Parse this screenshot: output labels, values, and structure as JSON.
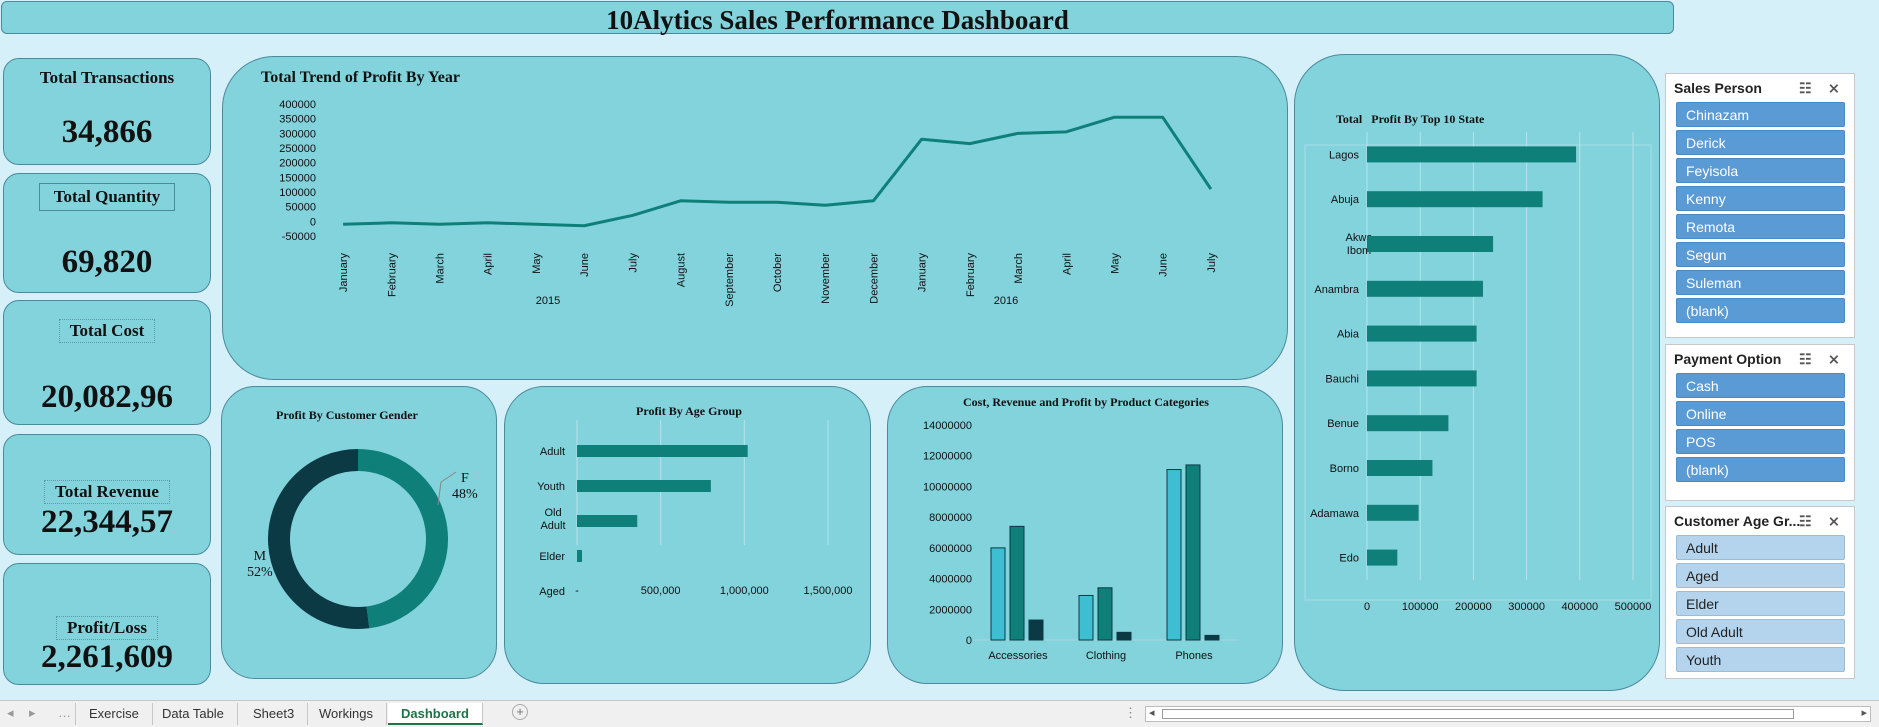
{
  "title": "10Alytics Sales Performance Dashboard",
  "kpis": [
    {
      "label": "Total Transactions",
      "value": "34,866"
    },
    {
      "label": "Total Quantity",
      "value": "69,820"
    },
    {
      "label": "Total Cost",
      "value": "20,082,96"
    },
    {
      "label": "Total Revenue",
      "value": "22,344,57"
    },
    {
      "label": "Profit/Loss",
      "value": "2,261,609"
    }
  ],
  "trend": {
    "title": "Total Trend of Profit By Year",
    "y_ticks": [
      "400000",
      "350000",
      "300000",
      "250000",
      "200000",
      "150000",
      "100000",
      "50000",
      "0",
      "-50000"
    ],
    "months": [
      "January",
      "February",
      "March",
      "April",
      "May",
      "June",
      "July",
      "August",
      "September",
      "October",
      "November",
      "December",
      "January",
      "February",
      "March",
      "April",
      "May",
      "June",
      "July"
    ],
    "years": [
      "2015",
      "2016"
    ],
    "chart_data": {
      "type": "line",
      "x": [
        "January",
        "February",
        "March",
        "April",
        "May",
        "June",
        "July",
        "August",
        "September",
        "October",
        "November",
        "December",
        "January",
        "February",
        "March",
        "April",
        "May",
        "June",
        "July"
      ],
      "values": [
        -10000,
        -5000,
        -10000,
        -5000,
        -10000,
        -15000,
        20000,
        70000,
        65000,
        65000,
        55000,
        70000,
        280000,
        265000,
        300000,
        305000,
        355000,
        355000,
        110000
      ],
      "ylim": [
        -50000,
        400000
      ],
      "color": "#0f7f7a"
    }
  },
  "states": {
    "title": "Total   Profit By Top 10 State",
    "x_ticks": [
      "0",
      "100000",
      "200000",
      "300000",
      "400000",
      "500000"
    ],
    "chart_data": {
      "type": "bar",
      "categories": [
        "Lagos",
        "Abuja",
        "Akwa Ibom",
        "Anambra",
        "Abia",
        "Bauchi",
        "Benue",
        "Borno",
        "Adamawa",
        "Edo"
      ],
      "values": [
        393000,
        330000,
        237000,
        218000,
        206000,
        206000,
        153000,
        123000,
        97000,
        57000
      ],
      "xlim": [
        0,
        500000
      ],
      "color": "#0f7f7a"
    }
  },
  "gender": {
    "title": "Profit By Customer Gender",
    "m_label": "M",
    "m_pct": "52%",
    "f_label": "F",
    "f_pct": "48%",
    "chart_data": {
      "type": "pie",
      "categories": [
        "F",
        "M"
      ],
      "values": [
        48,
        52
      ],
      "colors": [
        "#0f7f7a",
        "#0b3a45"
      ]
    }
  },
  "age": {
    "title": "Profit By Age Group",
    "x_ticks": [
      "-",
      "500,000",
      "1,000,000",
      "1,500,000"
    ],
    "chart_data": {
      "type": "bar",
      "categories": [
        "Adult",
        "Youth",
        "Old Adult",
        "Elder",
        "Aged"
      ],
      "values": [
        1020000,
        800000,
        360000,
        30000,
        0
      ],
      "xlim": [
        0,
        1500000
      ],
      "color": "#0f7f7a"
    }
  },
  "categories": {
    "title": "Cost, Revenue and Profit by Product Categories",
    "y_ticks": [
      "14000000",
      "12000000",
      "10000000",
      "8000000",
      "6000000",
      "4000000",
      "2000000",
      "0"
    ],
    "chart_data": {
      "type": "bar",
      "categories": [
        "Accessories",
        "Clothing",
        "Phones"
      ],
      "series": [
        {
          "values": [
            6000000,
            2900000,
            11100000
          ],
          "color": "#3ebed1"
        },
        {
          "values": [
            7400000,
            3400000,
            11400000
          ],
          "color": "#0f7f7a"
        },
        {
          "values": [
            1300000,
            500000,
            300000
          ],
          "color": "#0b3a45"
        }
      ],
      "ylim": [
        0,
        14000000
      ]
    }
  },
  "slicers": [
    {
      "title": "Sales Person",
      "items": [
        "Chinazam",
        "Derick",
        "Feyisola",
        "Kenny",
        "Remota",
        "Segun",
        "Suleman",
        "(blank)"
      ]
    },
    {
      "title": "Payment Option",
      "items": [
        "Cash",
        "Online",
        "POS",
        "(blank)"
      ]
    },
    {
      "title": "Customer Age Gr...",
      "items": [
        "Adult",
        "Aged",
        "Elder",
        "Old Adult",
        "Youth"
      ]
    }
  ],
  "tabs": [
    "Exercise",
    "Data Table",
    "Sheet3",
    "Workings",
    "Dashboard"
  ],
  "icons": {
    "multi_select": "multi-select-icon",
    "clear_filter": "clear-filter-icon"
  }
}
